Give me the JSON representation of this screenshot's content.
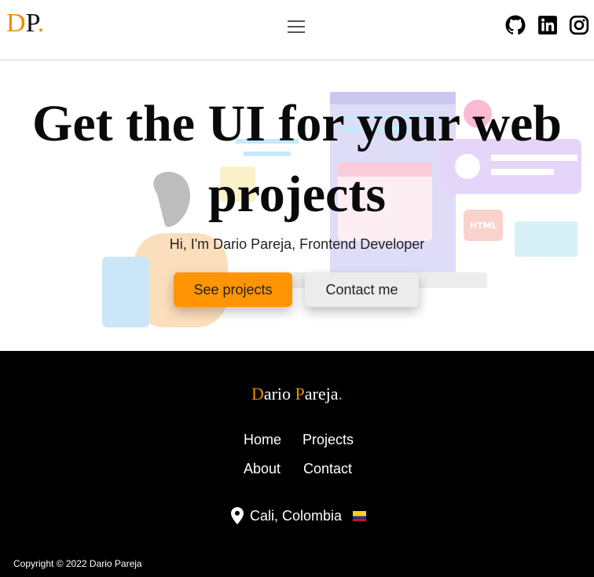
{
  "header": {
    "logo_d": "D",
    "logo_p": "P",
    "logo_dot": ".",
    "social": [
      "github-icon",
      "linkedin-icon",
      "instagram-icon"
    ]
  },
  "hero": {
    "title_line1": "Get the UI for your web",
    "title_line2": "projects",
    "subtitle": "Hi, I'm Dario Pareja, Frontend Developer",
    "primary_button": "See projects",
    "secondary_button": "Contact me",
    "illustration_labels": [
      "HTML"
    ]
  },
  "footer": {
    "brand_d": "D",
    "brand_ario": "ario ",
    "brand_p": "P",
    "brand_areja": "areja",
    "brand_dot": ".",
    "nav": [
      "Home",
      "Projects",
      "About",
      "Contact"
    ],
    "location": "Cali, Colombia",
    "copyright": "Copyright © 2022 Dario Pareja"
  },
  "colors": {
    "accent": "#ff9505",
    "footer_bg": "#000000"
  }
}
